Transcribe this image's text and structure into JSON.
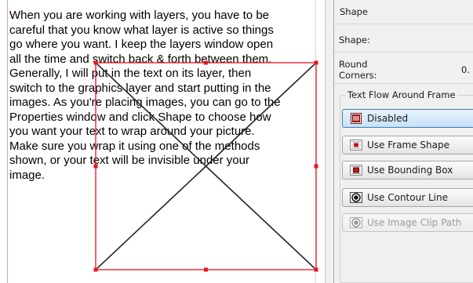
{
  "document": {
    "text_lines": [
      "When you are working with layers, you have to be",
      "careful that you know what layer is active so things",
      "go where you want. I keep the layers window open",
      "all the time and switch back & forth between them.",
      "Generally, I will put in the text on its layer, then",
      "switch to the graphics layer and start putting in the",
      "images. As you're placing images, you can go to the",
      "Properties window and click Shape to choose how",
      "you want your text to wrap around your picture.",
      "Make sure you wrap it using one of the methods",
      "shown, or your text will be invisible under your",
      "image."
    ]
  },
  "properties": {
    "header": "Shape",
    "shape_label": "Shape:",
    "round_corners_label": "Round Corners:",
    "round_corners_value": "0.",
    "text_flow_title": "Text Flow Around Frame",
    "buttons": [
      {
        "label": "Disabled",
        "icon": "text-flow-disabled-icon",
        "state": "selected"
      },
      {
        "label": "Use Frame Shape",
        "icon": "frame-shape-icon",
        "state": "normal"
      },
      {
        "label": "Use Bounding Box",
        "icon": "bounding-box-icon",
        "state": "normal"
      },
      {
        "label": "Use Contour Line",
        "icon": "contour-line-icon",
        "state": "normal"
      },
      {
        "label": "Use Image Clip Path",
        "icon": "image-clip-path-icon",
        "state": "disabled"
      }
    ]
  },
  "colors": {
    "frame_selection": "#e8141d",
    "accent_selected": "#3c7fb1",
    "icon_red": "#c0141c"
  }
}
